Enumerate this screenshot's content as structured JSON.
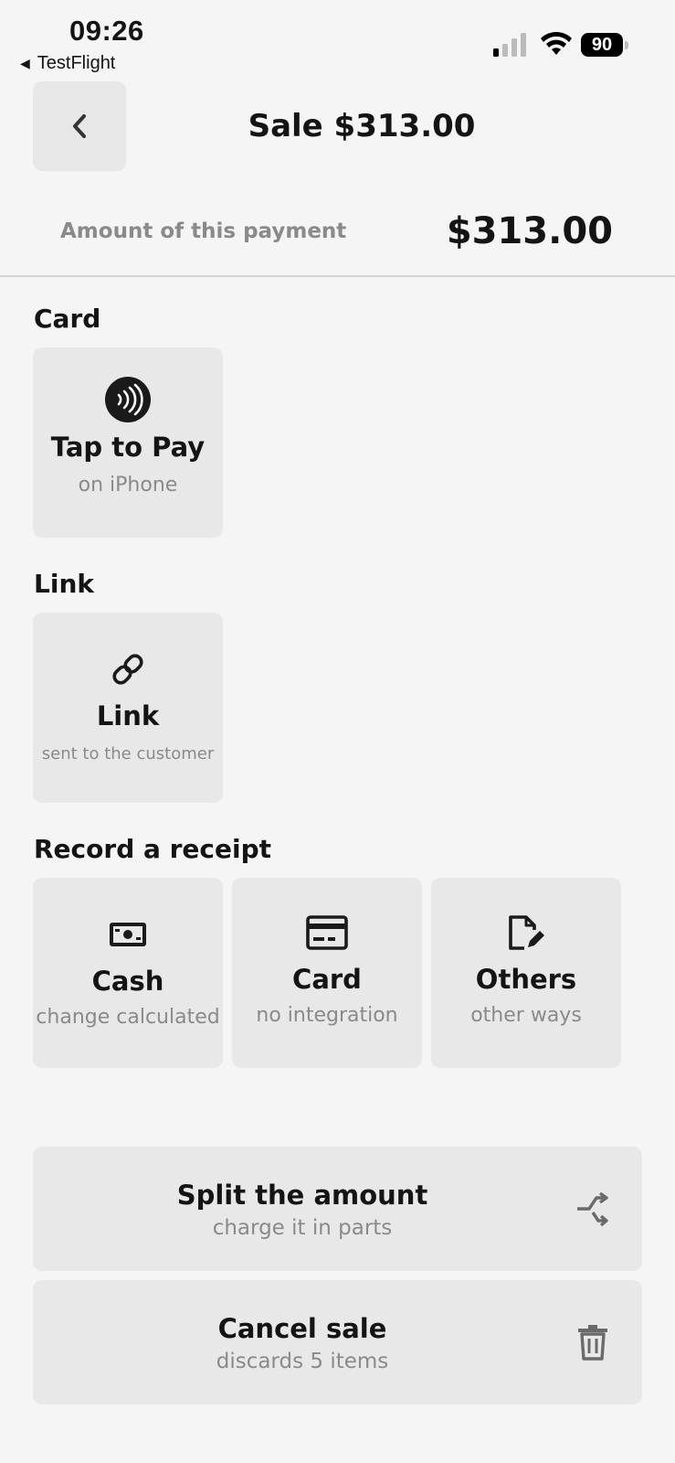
{
  "status_bar": {
    "time": "09:26",
    "back_app": "TestFlight",
    "battery": "90"
  },
  "header": {
    "title": "Sale $313.00"
  },
  "payment": {
    "amount_label": "Amount of this payment",
    "amount_value": "$313.00"
  },
  "card_section": {
    "title": "Card",
    "tap_to_pay": {
      "label": "Tap to Pay",
      "sub": "on iPhone",
      "icon": "contactless-icon"
    }
  },
  "link_section": {
    "title": "Link",
    "link": {
      "label": "Link",
      "sub": "sent to the customer",
      "icon": "link-icon"
    }
  },
  "receipt_section": {
    "title": "Record a receipt",
    "items": [
      {
        "label": "Cash",
        "sub": "change calculated",
        "icon": "cash-icon"
      },
      {
        "label": "Card",
        "sub": "no integration",
        "icon": "credit-card-icon"
      },
      {
        "label": "Others",
        "sub": "other ways",
        "icon": "edit-document-icon"
      }
    ]
  },
  "actions": {
    "split": {
      "label": "Split the amount",
      "sub": "charge it in parts",
      "icon": "split-icon"
    },
    "cancel": {
      "label": "Cancel sale",
      "sub": "discards 5 items",
      "icon": "trash-icon"
    }
  },
  "colors": {
    "background": "#f5f5f5",
    "tile": "#e8e8e8",
    "text": "#141414",
    "muted": "#8a8a8a"
  }
}
